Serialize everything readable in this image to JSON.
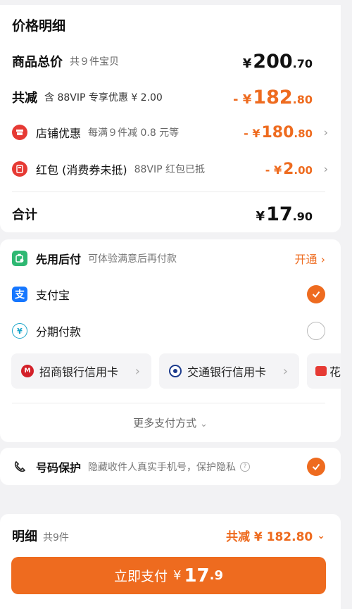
{
  "price_detail": {
    "title": "价格明细",
    "goods_total": {
      "label": "商品总价",
      "sub": "共９件宝贝",
      "currency": "¥",
      "integer": "200",
      "cents": ".70"
    },
    "total_discount": {
      "label": "共减",
      "sub": "含 88VIP 专享优惠 ¥ 2.00",
      "prefix": "- ¥",
      "integer": "182",
      "cents": ".80"
    },
    "shop_discount": {
      "label": "店铺优惠",
      "sub": "每满９件减 0.8 元等",
      "prefix": "- ¥",
      "integer": "180",
      "cents": ".80",
      "icon": "shop-coupon-icon"
    },
    "red_packet": {
      "label": "红包 (消费券未抵)",
      "sub": "88VIP 红包已抵",
      "prefix": "- ¥",
      "integer": "2",
      "cents": ".00",
      "icon": "red-packet-icon"
    },
    "sum": {
      "label": "合计",
      "currency": "¥",
      "integer": "17",
      "cents": ".90"
    }
  },
  "payment": {
    "pay_later": {
      "label": "先用后付",
      "sub": "可体验满意后再付款",
      "action": "开通",
      "icon": "pay-later-icon"
    },
    "alipay": {
      "label": "支付宝",
      "selected": true,
      "icon": "alipay-icon"
    },
    "installment": {
      "label": "分期付款",
      "selected": false,
      "icon": "installment-icon"
    },
    "banks": [
      {
        "label": "招商银行信用卡",
        "icon": "cmb-logo-icon"
      },
      {
        "label": "交通银行信用卡",
        "icon": "bocom-logo-icon"
      },
      {
        "label": "花",
        "icon": "huabei-icon"
      }
    ],
    "more": "更多支付方式"
  },
  "privacy": {
    "label": "号码保护",
    "sub": "隐藏收件人真实手机号，保护隐私",
    "selected": true,
    "icon": "phone-icon"
  },
  "bottom": {
    "label": "明细",
    "count": "共9件",
    "discount_text": "共减 ¥ 182.80",
    "button": {
      "text": "立即支付",
      "currency": "¥",
      "integer": "17",
      "decimal": ".9"
    }
  },
  "colors": {
    "accent": "#ee6b1f",
    "red_icon": "#e63a34",
    "alipay": "#1677ff",
    "pay_later": "#2eb872"
  }
}
